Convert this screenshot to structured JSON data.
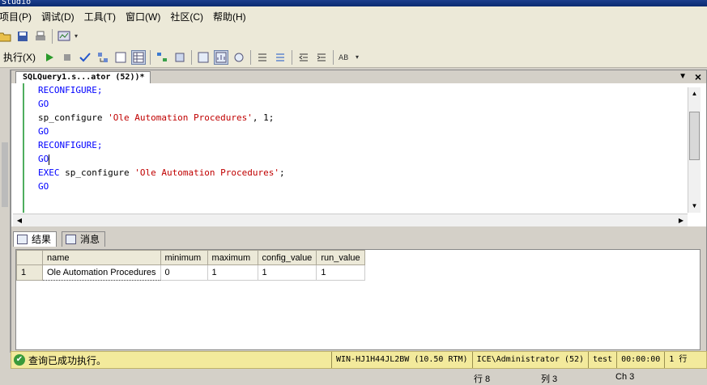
{
  "window": {
    "title_fragment": "Studio"
  },
  "menu": [
    "项目(P)",
    "调试(D)",
    "工具(T)",
    "窗口(W)",
    "社区(C)",
    "帮助(H)"
  ],
  "toolbar": {
    "execute_label": "执行(X)"
  },
  "editor": {
    "tab_title": "SQLQuery1.s...ator (52))*",
    "lines": [
      [
        {
          "t": "RECONFIGURE;",
          "c": "kw"
        }
      ],
      [
        {
          "t": "GO",
          "c": "kw"
        }
      ],
      [
        {
          "t": "sp_configure ",
          "c": "plain"
        },
        {
          "t": "'Ole Automation Procedures'",
          "c": "str"
        },
        {
          "t": ", 1;",
          "c": "plain"
        }
      ],
      [
        {
          "t": "GO",
          "c": "kw"
        }
      ],
      [
        {
          "t": "RECONFIGURE;",
          "c": "kw"
        }
      ],
      [
        {
          "t": "GO",
          "c": "kw"
        }
      ],
      [
        {
          "t": "EXEC ",
          "c": "kw"
        },
        {
          "t": "sp_configure ",
          "c": "plain"
        },
        {
          "t": "'Ole Automation Procedures'",
          "c": "str"
        },
        {
          "t": ";",
          "c": "plain"
        }
      ],
      [
        {
          "t": "GO",
          "c": "kw"
        }
      ]
    ]
  },
  "results": {
    "tabs": {
      "results": "结果",
      "messages": "消息"
    },
    "columns": [
      "name",
      "minimum",
      "maximum",
      "config_value",
      "run_value"
    ],
    "rows": [
      {
        "num": "1",
        "cells": [
          "Ole Automation Procedures",
          "0",
          "1",
          "1",
          "1"
        ]
      }
    ]
  },
  "status": {
    "message": "查询已成功执行。",
    "server": "WIN-HJ1H44JL2BW (10.50 RTM)",
    "user": "ICE\\Administrator (52)",
    "database": "test",
    "elapsed": "00:00:00",
    "rows": "1 行"
  },
  "bottom": {
    "line": "行 8",
    "col": "列 3",
    "ch": "Ch 3"
  }
}
